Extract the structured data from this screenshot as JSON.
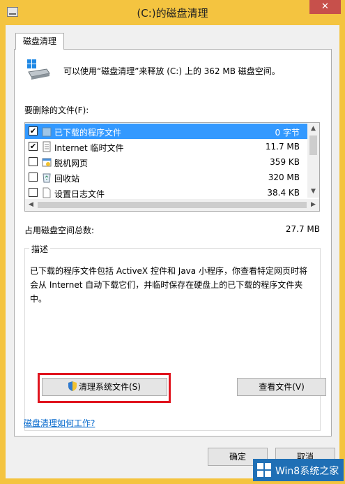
{
  "window": {
    "title": "(C:)的磁盘清理",
    "close_label": "✕"
  },
  "tab": {
    "label": "磁盘清理"
  },
  "header": {
    "text": "可以使用“磁盘清理”来释放 (C:) 上的 362 MB 磁盘空间。"
  },
  "files_label": "要删除的文件(F):",
  "files": [
    {
      "name": "已下载的程序文件",
      "size": "0 字节",
      "checked": "✔",
      "selected": true,
      "icon": "folder-icon"
    },
    {
      "name": "Internet 临时文件",
      "size": "11.7 MB",
      "checked": "✔",
      "selected": false,
      "icon": "document-icon"
    },
    {
      "name": "脱机网页",
      "size": "359 KB",
      "checked": "",
      "selected": false,
      "icon": "offline-page-icon"
    },
    {
      "name": "回收站",
      "size": "320 MB",
      "checked": "",
      "selected": false,
      "icon": "recycle-bin-icon"
    },
    {
      "name": "设置日志文件",
      "size": "38.4 KB",
      "checked": "",
      "selected": false,
      "icon": "blank-file-icon"
    }
  ],
  "total": {
    "label": "占用磁盘空间总数:",
    "value": "27.7 MB"
  },
  "description": {
    "caption": "描述",
    "text": "已下载的程序文件包括 ActiveX 控件和 Java 小程序，你查看特定网页时将会从 Internet 自动下载它们，并临时保存在硬盘上的已下载的程序文件夹中。"
  },
  "buttons": {
    "clean_system": "清理系统文件(S)",
    "view_files": "查看文件(V)",
    "ok": "确定",
    "cancel": "取消"
  },
  "help_link": "磁盘清理如何工作?",
  "watermark": {
    "text": "Win8系统之家"
  },
  "colors": {
    "titlebar": "#f4c440",
    "selection": "#3399ff",
    "close": "#c7504b",
    "highlight": "#e0141e",
    "link": "#0066cc"
  }
}
